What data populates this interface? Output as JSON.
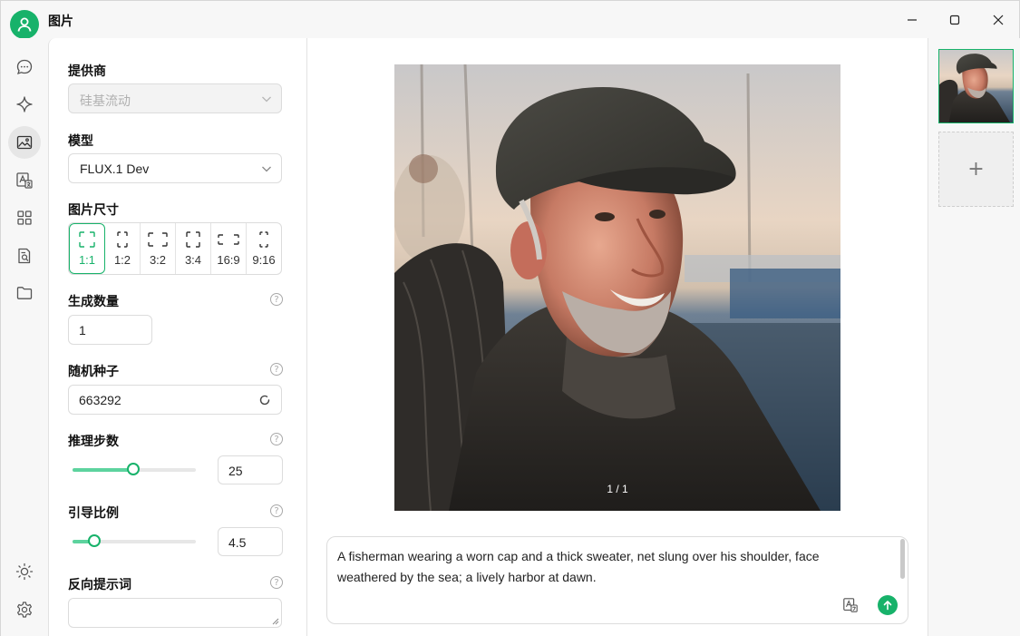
{
  "app": {
    "title": "图片",
    "accent_color": "#17b26a",
    "avatar_icon": "user-icon"
  },
  "window_controls": [
    "minimize-icon",
    "maximize-icon",
    "close-icon"
  ],
  "nav": {
    "items": [
      {
        "name": "chat",
        "icon": "chat-bubble-icon",
        "active": false
      },
      {
        "name": "assistant",
        "icon": "sparkle-icon",
        "active": false
      },
      {
        "name": "image",
        "icon": "image-icon",
        "active": true
      },
      {
        "name": "translate",
        "icon": "translate-icon",
        "active": false
      },
      {
        "name": "apps",
        "icon": "grid-icon",
        "active": false
      },
      {
        "name": "knowledge",
        "icon": "document-search-icon",
        "active": false
      },
      {
        "name": "files",
        "icon": "folder-icon",
        "active": false
      }
    ],
    "bottom": [
      {
        "name": "theme",
        "icon": "sun-icon"
      },
      {
        "name": "settings",
        "icon": "gear-icon"
      }
    ]
  },
  "settings": {
    "provider": {
      "label": "提供商",
      "value": "硅基流动",
      "disabled": true
    },
    "model": {
      "label": "模型",
      "value": "FLUX.1 Dev"
    },
    "image_size": {
      "label": "图片尺寸",
      "options": [
        "1:1",
        "1:2",
        "3:2",
        "3:4",
        "16:9",
        "9:16"
      ],
      "selected": "1:1"
    },
    "num_images": {
      "label": "生成数量",
      "value": "1"
    },
    "seed": {
      "label": "随机种子",
      "value": "663292"
    },
    "steps": {
      "label": "推理步数",
      "value": "25",
      "slider_fraction": 0.49
    },
    "guidance": {
      "label": "引导比例",
      "value": "4.5",
      "slider_fraction": 0.18
    },
    "negative_prompt": {
      "label": "反向提示词",
      "value": ""
    }
  },
  "viewer": {
    "counter": "1 / 1"
  },
  "prompt": {
    "text": "A fisherman wearing a worn cap and a thick sweater, net slung over his shoulder, face weathered by the sea; a lively harbor at dawn."
  },
  "gallery": {
    "add_label": "+"
  }
}
